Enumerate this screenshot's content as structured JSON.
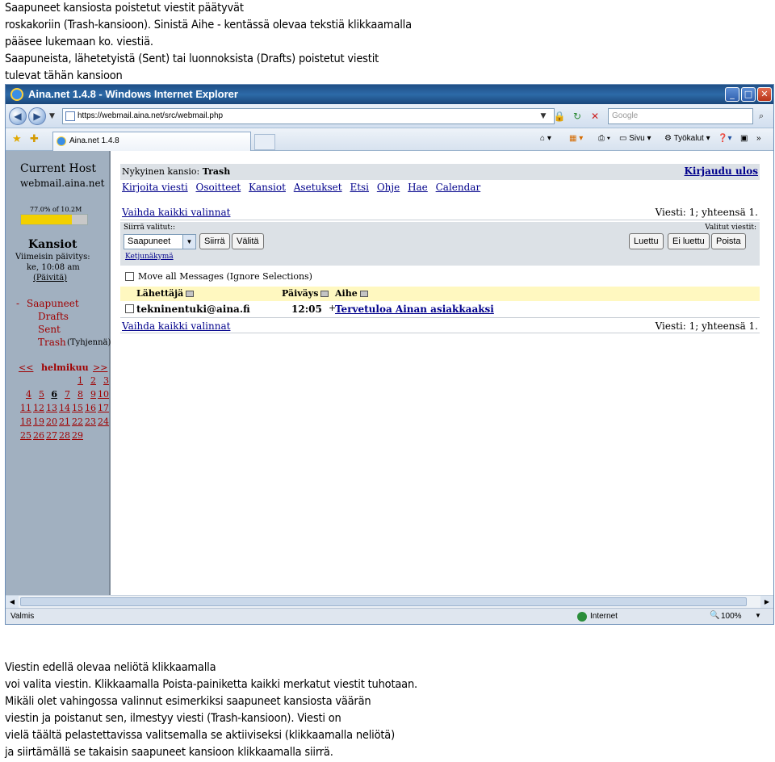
{
  "caption_top": [
    "Saapuneet kansiosta poistetut viestit päätyvät",
    "roskakoriin (Trash-kansioon). Sinistä Aihe - kentässä olevaa tekstiä klikkaamalla",
    "pääsee lukemaan ko. viestiä.",
    "Saapuneista, lähetetyistä (Sent) tai luonnoksista (Drafts) poistetut viestit",
    "tulevat tähän kansioon"
  ],
  "caption_bottom": [
    "Viestin edellä olevaa neliötä klikkaamalla",
    "voi valita viestin. Klikkaamalla Poista-painiketta kaikki merkatut viestit tuhotaan.",
    "Mikäli olet vahingossa valinnut esimerkiksi saapuneet kansiosta väärän",
    "viestin ja poistanut sen, ilmestyy viesti (Trash-kansioon). Viesti on",
    "vielä täältä pelastettavissa valitsemalla se aktiiviseksi (klikkaamalla neliötä)",
    "ja siirtämällä se takaisin saapuneet kansioon klikkaamalla siirrä."
  ],
  "browser": {
    "title": "Aina.net 1.4.8 - Windows Internet Explorer",
    "url": "https://webmail.aina.net/src/webmail.php",
    "search_placeholder": "Google",
    "tab_label": "Aina.net 1.4.8",
    "toolbar": {
      "page": "Sivu",
      "tools": "Työkalut"
    },
    "status": "Valmis",
    "zone": "Internet",
    "zoom": "100%"
  },
  "sidebar": {
    "host_label": "Current Host",
    "host_name": "webmail.aina.net",
    "quota_text": "77.0% of 10.2M",
    "quota_fraction": 0.77,
    "folders_title": "Kansiot",
    "last_update_label": "Viimeisin päivitys:",
    "last_update_time": "ke, 10:08 am",
    "refresh_label": "(Päivitä)",
    "folders": {
      "inbox": "Saapuneet",
      "drafts": "Drafts",
      "sent": "Sent",
      "trash": "Trash",
      "empty_trash": "(Tyhjennä)"
    },
    "calendar": {
      "prev": "<<",
      "month": "helmikuu",
      "next": ">>",
      "today": 6,
      "weeks": [
        [
          "",
          "",
          "",
          "",
          "1",
          "2",
          "3"
        ],
        [
          "4",
          "5",
          "6",
          "7",
          "8",
          "9",
          "10"
        ],
        [
          "11",
          "12",
          "13",
          "14",
          "15",
          "16",
          "17"
        ],
        [
          "18",
          "19",
          "20",
          "21",
          "22",
          "23",
          "24"
        ],
        [
          "25",
          "26",
          "27",
          "28",
          "29",
          "",
          ""
        ]
      ]
    }
  },
  "main": {
    "current_folder_label": "Nykyinen kansio: ",
    "current_folder_name": "Trash",
    "logout": "Kirjaudu ulos",
    "menu": [
      "Kirjoita viesti",
      "Osoitteet",
      "Kansiot",
      "Asetukset",
      "Etsi",
      "Ohje",
      "Hae",
      "Calendar"
    ],
    "toggle_all": "Vaihda kaikki valinnat",
    "message_count": "Viesti: 1; yhteensä 1.",
    "move_label": "Siirrä valitut::",
    "selected_label": "Valitut viestit:",
    "folder_select_value": "Saapuneet",
    "buttons": {
      "move": "Siirrä",
      "forward": "Välitä",
      "read": "Luettu",
      "unread": "Ei luettu",
      "delete": "Poista"
    },
    "thread_view": "Ketjunäkymä",
    "move_all_label": "Move all Messages (Ignore Selections)",
    "columns": {
      "from": "Lähettäjä",
      "date": "Päiväys",
      "subject": "Aihe"
    },
    "message": {
      "from": "tekninentuki@aina.fi",
      "date": "12:05",
      "flag": "+",
      "subject": "Tervetuloa Ainan asiakkaaksi"
    }
  }
}
